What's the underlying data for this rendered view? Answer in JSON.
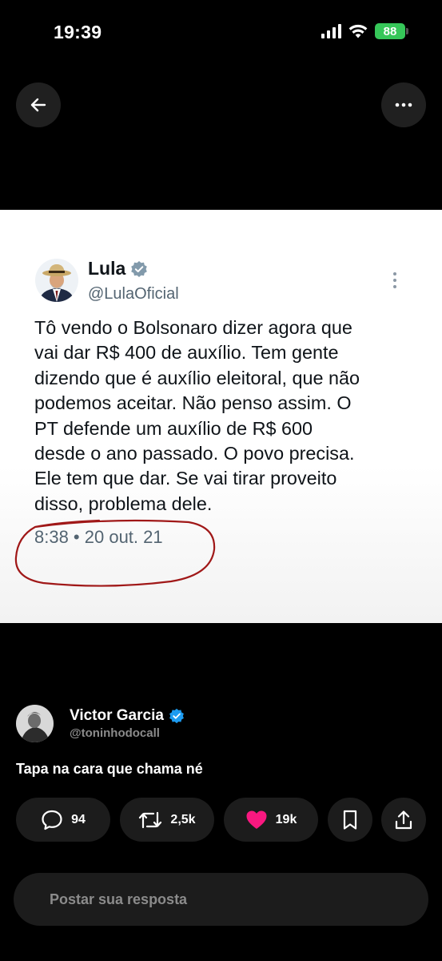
{
  "status_bar": {
    "time": "19:39",
    "battery": "88",
    "icons": [
      "signal-icon",
      "wifi-icon",
      "battery-charging-icon"
    ]
  },
  "header": {
    "back_icon": "arrow-left-icon",
    "more_icon": "more-horizontal-icon"
  },
  "embedded_tweet": {
    "author_name": "Lula",
    "author_handle": "@LulaOficial",
    "verified": true,
    "lines": [
      "Tô vendo o Bolsonaro dizer agora que",
      "vai dar R$ 400 de auxílio. Tem gente",
      "dizendo que é auxílio eleitoral, que não",
      "podemos aceitar. Não penso assim. O",
      "PT defende um auxílio de R$ 600",
      "desde o ano passado. O povo precisa.",
      "Ele tem que dar. Se vai tirar proveito",
      "disso, problema dele."
    ],
    "timestamp": "8:38 • 20 out. 21",
    "annotation_color": "#a01818"
  },
  "reply_post": {
    "author_name": "Victor Garcia",
    "author_handle": "@toninhodocall",
    "verified": true,
    "text": "Tapa na cara que chama né"
  },
  "actions": {
    "replies": "94",
    "reposts": "2,5k",
    "likes": "19k",
    "like_color": "#f91880"
  },
  "composer": {
    "placeholder": "Postar sua resposta"
  },
  "colors": {
    "background": "#000000",
    "verified_blue": "#1d9bf0",
    "battery_green": "#36c759"
  }
}
